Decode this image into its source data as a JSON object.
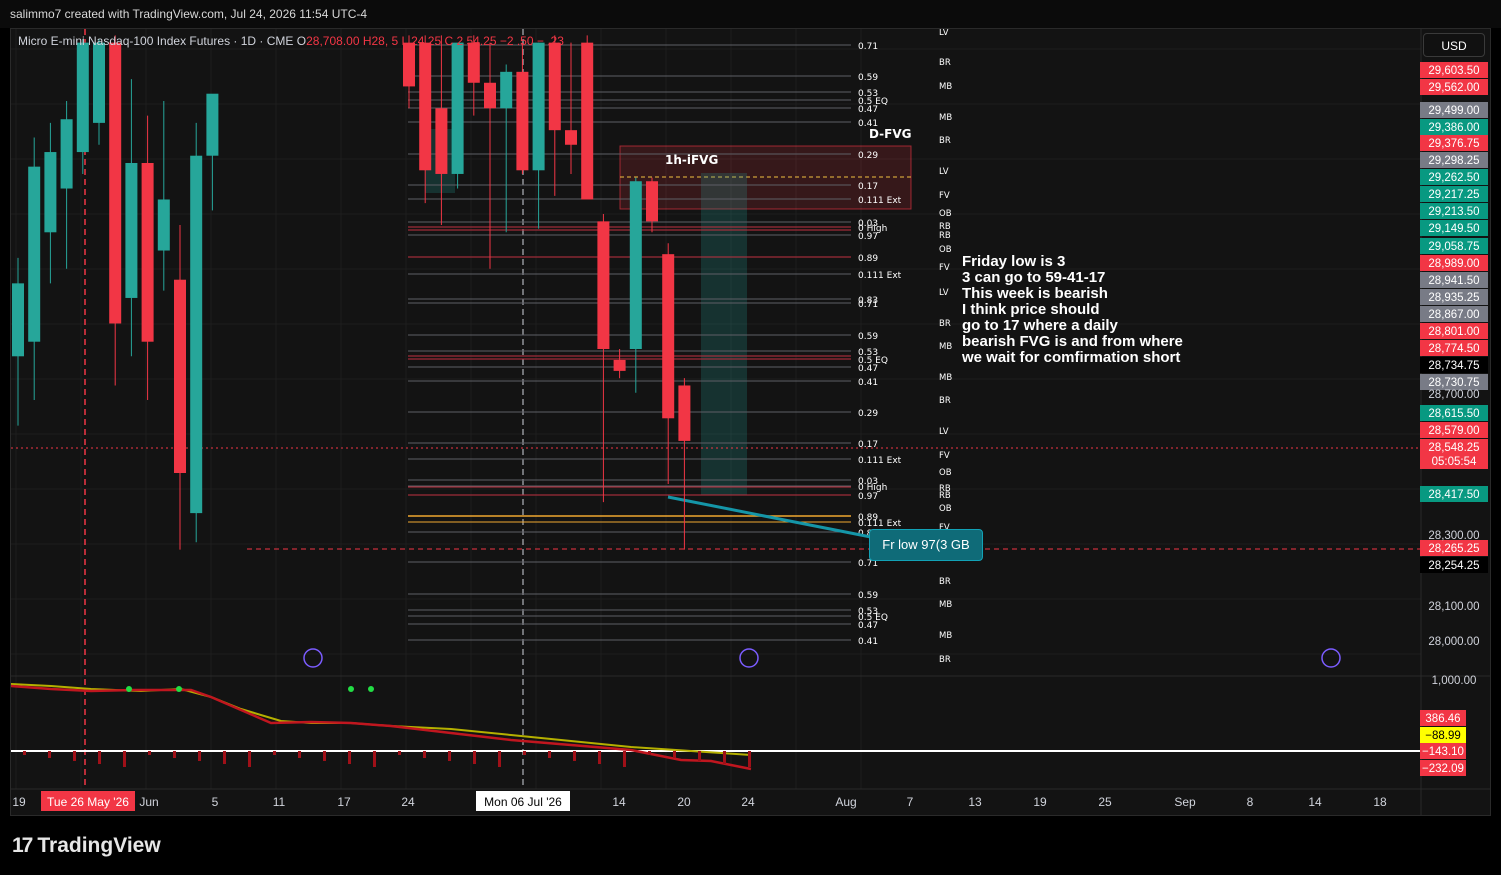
{
  "header": {
    "credit": "salimmo7 created with TradingView.com, Jul 24, 2026 11:54 UTC-4"
  },
  "legend": {
    "symbol": "Micro E-mini Nasdaq-100 Index Futures · 1D · CME",
    "o": "O",
    "o_value": "28,708.00",
    "rest": "H28,  5  L   24.25  C 2  54.25  −2 .50  −  .23  "
  },
  "currency": "USD",
  "brand": "TradingView",
  "note": {
    "lines": [
      "Friday low is 3",
      "3 can go to 59-41-17",
      "This week is bearish",
      "I think price should",
      "go to 17 where a daily",
      "bearish FVG is and from where",
      "we wait for comfirmation short"
    ]
  },
  "fr_low_label": "Fr low 97(3 GB",
  "labels": {
    "d_fvg": "D-FVG",
    "h1_ifvg": "1h-iFVG"
  },
  "colors": {
    "bull": "#26a69a",
    "bear": "#f23645",
    "bg": "#131313",
    "grid": "#1e1e1e",
    "gold": "#f0a830",
    "teal": "#1596a8"
  },
  "time_axis": {
    "ticks": [
      {
        "label": "19"
      },
      {
        "label": "Jun"
      },
      {
        "label": "5"
      },
      {
        "label": "11"
      },
      {
        "label": "17"
      },
      {
        "label": "24"
      },
      {
        "label": "14"
      },
      {
        "label": "20"
      },
      {
        "label": "24"
      },
      {
        "label": "Aug"
      },
      {
        "label": "7"
      },
      {
        "label": "13"
      },
      {
        "label": "19"
      },
      {
        "label": "25"
      },
      {
        "label": "Sep"
      },
      {
        "label": "8"
      },
      {
        "label": "14"
      },
      {
        "label": "18"
      }
    ],
    "flags": [
      {
        "label": "Tue 26 May '26",
        "color": "#f23645"
      },
      {
        "label": "Mon 06 Jul '26",
        "color": "#ffffff"
      }
    ]
  },
  "price_axis": {
    "plain": [
      "28,700.00",
      "28,300.00",
      "28,100.00",
      "28,000.00",
      "1,000.00"
    ],
    "tags": [
      {
        "label": "29,603.50",
        "color": "#f23645"
      },
      {
        "label": "29,562.00",
        "color": "#f23645"
      },
      {
        "label": "29,499.00",
        "color": "#787b86"
      },
      {
        "label": "29,386.00",
        "color": "#089981"
      },
      {
        "label": "29,376.75",
        "color": "#f23645"
      },
      {
        "label": "29,298.25",
        "color": "#787b86"
      },
      {
        "label": "29,262.50",
        "color": "#089981"
      },
      {
        "label": "29,217.25",
        "color": "#089981"
      },
      {
        "label": "29,213.50",
        "color": "#089981"
      },
      {
        "label": "29,149.50",
        "color": "#089981"
      },
      {
        "label": "29,058.75",
        "color": "#089981"
      },
      {
        "label": "28,989.00",
        "color": "#f23645"
      },
      {
        "label": "28,941.50",
        "color": "#787b86"
      },
      {
        "label": "28,935.25",
        "color": "#787b86"
      },
      {
        "label": "28,867.00",
        "color": "#787b86"
      },
      {
        "label": "28,801.00",
        "color": "#f23645"
      },
      {
        "label": "28,774.50",
        "color": "#f23645"
      },
      {
        "label": "28,734.75",
        "color": "#000000"
      },
      {
        "label": "28,730.75",
        "color": "#787b86"
      },
      {
        "label": "28,615.50",
        "color": "#089981"
      },
      {
        "label": "28,579.00",
        "color": "#f23645"
      },
      {
        "label": "28,548.25",
        "color": "#f23645"
      },
      {
        "label": "05:05:54",
        "color": "#f23645"
      },
      {
        "label": "28,417.50",
        "color": "#089981"
      },
      {
        "label": "28,265.25",
        "color": "#f23645"
      },
      {
        "label": "28,254.25",
        "color": "#000000"
      }
    ],
    "osc_tags": [
      {
        "label": "386.46",
        "color": "#f23645"
      },
      {
        "label": "−88.99",
        "color": "#ffff00"
      },
      {
        "label": "−143.10",
        "color": "#f23645"
      },
      {
        "label": "−232.09",
        "color": "#f23645"
      }
    ]
  },
  "fib_group_1": {
    "levels": [
      "0.71",
      "0.59",
      "0.53",
      "0.5 EQ",
      "0.47",
      "0.41",
      "0.29",
      "0.17",
      "0.111 Ext",
      "0.03",
      "0 High",
      "0.97",
      "0.89",
      "0.111 Ext",
      "0.83"
    ],
    "tags": [
      "LV",
      "BR",
      "MB",
      "MB",
      "BR",
      "LV",
      "FV",
      "OB",
      "RB",
      "RB",
      "OB",
      "FV"
    ]
  },
  "fib_group_2": {
    "levels": [
      "0.71",
      "0.59",
      "0.53",
      "0.5 EQ",
      "0.47",
      "0.41",
      "0.29",
      "0.17",
      "0.111 Ext",
      "0.03",
      "0 High",
      "0.97",
      "0.89",
      "0.111 Ext",
      "0.83",
      "0.71",
      "0.59",
      "0.53",
      "0.5 EQ",
      "0.47",
      "0.41"
    ],
    "tags": [
      "LV",
      "BR",
      "MB",
      "MB",
      "BR",
      "LV",
      "FV",
      "OB",
      "RB",
      "RB",
      "OB",
      "FV",
      "LV",
      "BR",
      "MB",
      "MB",
      "BR"
    ]
  },
  "chart_data": {
    "type": "candlestick",
    "title": "Micro E-mini Nasdaq-100 Index Futures · 1D · CME",
    "y_range": [
      27950,
      29650
    ],
    "candles": [
      {
        "o": 28780,
        "h": 29050,
        "l": 28590,
        "c": 28980
      },
      {
        "o": 28820,
        "h": 29380,
        "l": 28660,
        "c": 29300
      },
      {
        "o": 29120,
        "h": 29420,
        "l": 28980,
        "c": 29340
      },
      {
        "o": 29240,
        "h": 29480,
        "l": 29020,
        "c": 29430
      },
      {
        "o": 29340,
        "h": 29650,
        "l": 29280,
        "c": 29640
      },
      {
        "o": 29420,
        "h": 29650,
        "l": 29360,
        "c": 29640
      },
      {
        "o": 29640,
        "h": 29660,
        "l": 28700,
        "c": 28870
      },
      {
        "o": 28940,
        "h": 29540,
        "l": 28780,
        "c": 29310
      },
      {
        "o": 29310,
        "h": 29440,
        "l": 28660,
        "c": 28820
      },
      {
        "o": 29070,
        "h": 29480,
        "l": 28960,
        "c": 29210
      },
      {
        "o": 28990,
        "h": 29140,
        "l": 28250,
        "c": 28460
      },
      {
        "o": 28350,
        "h": 29420,
        "l": 28270,
        "c": 29330
      },
      {
        "o": 29330,
        "h": 29480,
        "l": 29180,
        "c": 29500
      }
    ],
    "candles_right": [
      {
        "o": 29640,
        "h": 29660,
        "l": 29460,
        "c": 29520
      },
      {
        "o": 29640,
        "h": 29660,
        "l": 29200,
        "c": 29290
      },
      {
        "o": 29460,
        "h": 29660,
        "l": 29140,
        "c": 29280
      },
      {
        "o": 29280,
        "h": 29460,
        "l": 29240,
        "c": 29640
      },
      {
        "o": 29640,
        "h": 29660,
        "l": 29440,
        "c": 29530
      },
      {
        "o": 29530,
        "h": 29640,
        "l": 29020,
        "c": 29460
      },
      {
        "o": 29460,
        "h": 29580,
        "l": 29120,
        "c": 29560
      },
      {
        "o": 29560,
        "h": 29640,
        "l": 29280,
        "c": 29290
      },
      {
        "o": 29290,
        "h": 29640,
        "l": 29130,
        "c": 29640
      },
      {
        "o": 29640,
        "h": 29660,
        "l": 29220,
        "c": 29400
      },
      {
        "o": 29400,
        "h": 29640,
        "l": 29280,
        "c": 29360
      },
      {
        "o": 29640,
        "h": 29660,
        "l": 29220,
        "c": 29210
      },
      {
        "o": 29150,
        "h": 29170,
        "l": 28380,
        "c": 28800
      },
      {
        "o": 28770,
        "h": 28800,
        "l": 28720,
        "c": 28740
      },
      {
        "o": 28800,
        "h": 29270,
        "l": 28680,
        "c": 29260
      },
      {
        "o": 29260,
        "h": 29270,
        "l": 29120,
        "c": 29150
      },
      {
        "o": 29060,
        "h": 29090,
        "l": 28430,
        "c": 28610
      },
      {
        "o": 28700,
        "h": 28720,
        "l": 28250,
        "c": 28548
      }
    ],
    "oscillator": {
      "values": [
        "386.46",
        "−88.99",
        "−143.10",
        "−232.09"
      ]
    }
  }
}
